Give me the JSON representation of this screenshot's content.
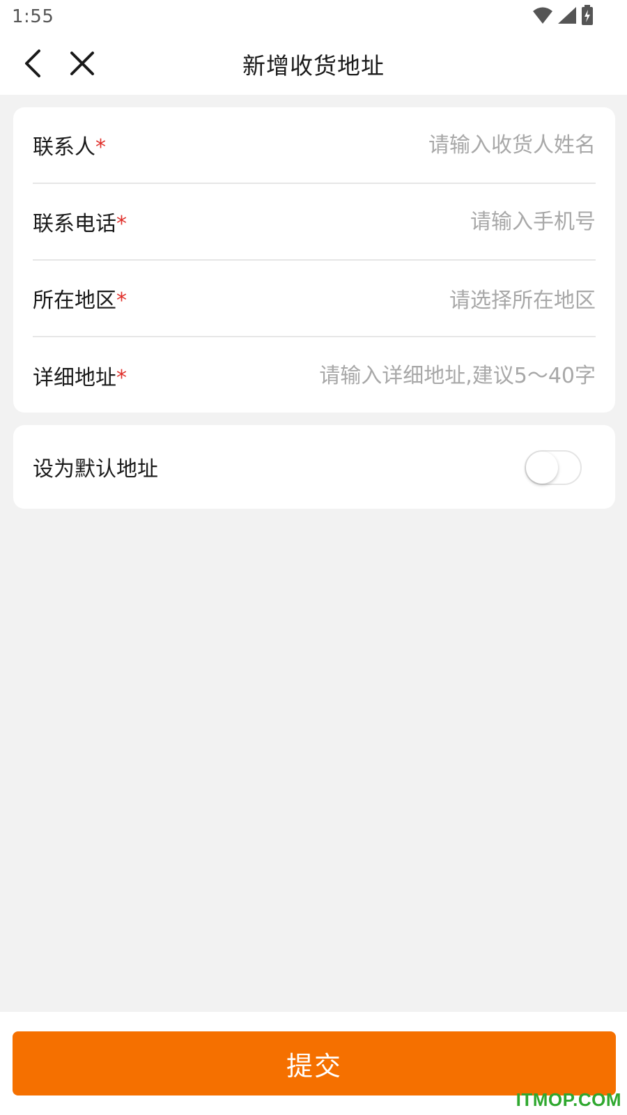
{
  "status_bar": {
    "time": "1:55",
    "icons": [
      "wifi-icon",
      "signal-icon",
      "battery-charging-icon"
    ]
  },
  "header": {
    "title": "新增收货地址",
    "back_icon": "chevron-left-icon",
    "close_icon": "close-icon"
  },
  "form": {
    "contact_name": {
      "label": "联系人",
      "required_mark": "*",
      "placeholder": "请输入收货人姓名",
      "value": ""
    },
    "contact_phone": {
      "label": "联系电话",
      "required_mark": "*",
      "placeholder": "请输入手机号",
      "value": ""
    },
    "region": {
      "label": "所在地区",
      "required_mark": "*",
      "placeholder": "请选择所在地区"
    },
    "detail_address": {
      "label": "详细地址",
      "required_mark": "*",
      "placeholder": "请输入详细地址,建议5～40字",
      "value": ""
    }
  },
  "default_address": {
    "label": "设为默认地址",
    "enabled": false
  },
  "submit": {
    "label": "提交"
  },
  "watermark": {
    "text": "ITMOP.COM"
  },
  "colors": {
    "accent": "#f57000",
    "required": "#e0302b",
    "placeholder": "#a8a8a8",
    "background": "#f2f2f2",
    "watermark": "#2fa82f"
  }
}
